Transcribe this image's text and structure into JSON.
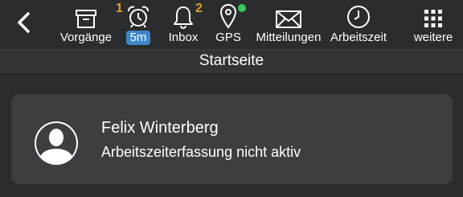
{
  "nav": {
    "back_icon": "chevron-left-icon",
    "items": [
      {
        "label": "Vorgänge",
        "icon": "archive-box-icon",
        "badge": "1"
      },
      {
        "label": "5m",
        "icon": "alarm-clock-icon"
      },
      {
        "label": "Inbox",
        "icon": "bell-icon",
        "badge": "2"
      },
      {
        "label": "GPS",
        "icon": "map-pin-icon",
        "status": "active"
      },
      {
        "label": "Mitteilungen",
        "icon": "envelope-icon"
      },
      {
        "label": "Arbeitszeit",
        "icon": "clock-icon"
      },
      {
        "label": "weitere",
        "icon": "grid-dots-icon"
      }
    ]
  },
  "page": {
    "title": "Startseite"
  },
  "user_card": {
    "name": "Felix Winterberg",
    "status": "Arbeitszeiterfassung nicht aktiv",
    "avatar_icon": "user-avatar-icon"
  },
  "colors": {
    "background": "#2b2c2e",
    "card": "#3d3e41",
    "badge": "#e59c2a",
    "gps_dot": "#37c85a",
    "pill": "#3f86c8"
  }
}
